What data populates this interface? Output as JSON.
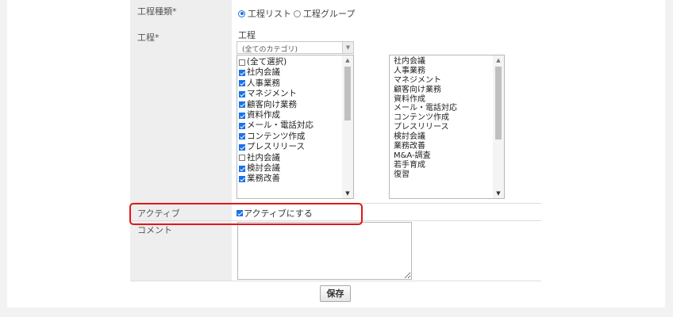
{
  "form": {
    "process_type": {
      "label": "工程種類*",
      "options": [
        {
          "label": "工程リスト",
          "selected": true
        },
        {
          "label": "工程グループ",
          "selected": false
        }
      ]
    },
    "process": {
      "label": "工程*",
      "title": "工程",
      "category_select": "(全てのカテゴリ)",
      "available_items": [
        {
          "label": "(全て選択)",
          "checked": false
        },
        {
          "label": "社内会議",
          "checked": true
        },
        {
          "label": "人事業務",
          "checked": true
        },
        {
          "label": "マネジメント",
          "checked": true
        },
        {
          "label": "顧客向け業務",
          "checked": true
        },
        {
          "label": "資料作成",
          "checked": true
        },
        {
          "label": "メール・電話対応",
          "checked": true
        },
        {
          "label": "コンテンツ作成",
          "checked": true
        },
        {
          "label": "プレスリリース",
          "checked": true
        },
        {
          "label": "社内会議",
          "checked": false
        },
        {
          "label": "検討会議",
          "checked": true
        },
        {
          "label": "業務改善",
          "checked": true
        }
      ],
      "selected_items": [
        "社内会議",
        "人事業務",
        "マネジメント",
        "顧客向け業務",
        "資料作成",
        "メール・電話対応",
        "コンテンツ作成",
        "プレスリリース",
        "検討会議",
        "業務改善",
        "M&A-調査",
        "若手育成",
        "復習"
      ]
    },
    "active": {
      "label": "アクティブ",
      "checkbox_label": "アクティブにする",
      "checked": true
    },
    "comment": {
      "label": "コメント",
      "value": ""
    },
    "save_label": "保存"
  },
  "colors": {
    "accent": "#1a73e8",
    "highlight": "#e01818",
    "label_bg": "#eeeeee"
  }
}
